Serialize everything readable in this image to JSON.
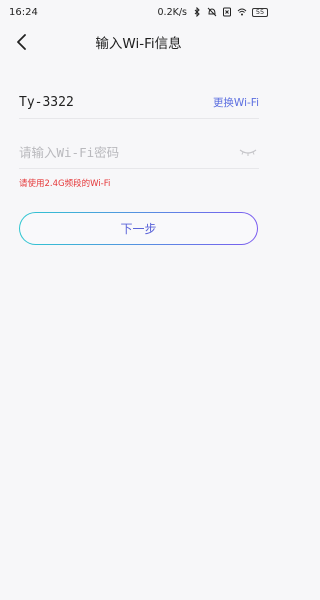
{
  "status_bar": {
    "time": "16:24",
    "network_speed": "0.2K/s",
    "battery": "55",
    "icons": [
      "bluetooth-icon",
      "alarm-mute-icon",
      "sim-off-icon",
      "wifi-icon",
      "battery-icon"
    ]
  },
  "header": {
    "back_icon": "chevron-left-icon",
    "title": "输入Wi-Fi信息"
  },
  "wifi": {
    "ssid": "Ty-3322",
    "change_label": "更换Wi-Fi"
  },
  "password": {
    "placeholder": "请输入Wi-Fi密码",
    "value": "",
    "visibility_icon": "eye-closed-icon"
  },
  "hint": "请使用2.4G频段的Wi-Fi",
  "next_button": {
    "label": "下一步"
  },
  "colors": {
    "accent": "#5b6ee0",
    "error": "#e5393b",
    "gradient_start": "#2fc7d1",
    "gradient_end": "#7b5cf0",
    "background": "#f7f7f9"
  }
}
